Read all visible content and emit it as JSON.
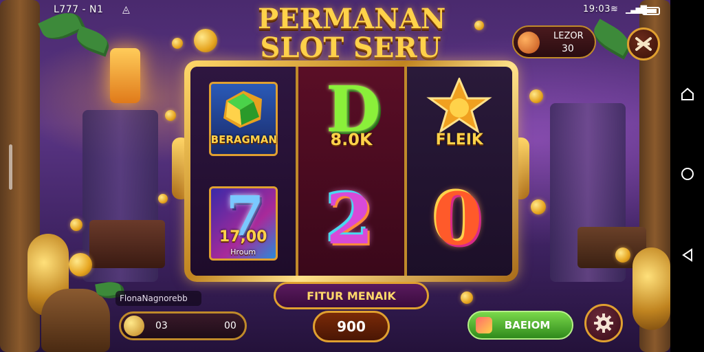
{
  "status_bar": {
    "left_text": "L777 - N1",
    "right_text": "19:03"
  },
  "title": {
    "line1": "PERMANAN",
    "line2": "SLOT SERU"
  },
  "top_right": {
    "lezor_label": "LEZOR",
    "lezor_value": "30"
  },
  "reels": [
    {
      "top": {
        "symbol": "gem-icon",
        "label": "BERAGMAN"
      },
      "bottom": {
        "symbol": "seven-icon",
        "digit": "7",
        "label": "17,00",
        "sublabel": "Hroum"
      }
    },
    {
      "top": {
        "symbol": "d-icon",
        "digit": "D",
        "label": "8.0K"
      },
      "bottom": {
        "symbol": "two-icon",
        "digit": "2"
      }
    },
    {
      "top": {
        "symbol": "star-icon",
        "label": "FLEIK"
      },
      "bottom": {
        "symbol": "zero-icon",
        "digit": "0"
      }
    }
  ],
  "controls": {
    "feature_label": "FITUR MENAIK",
    "bet_value": "900",
    "player_name": "FlonaNagnorebb",
    "balance_left": "03",
    "balance_right": "00",
    "bonus_label": "BAEIOM"
  },
  "colors": {
    "gold": "#e0a030",
    "bonus_green": "#3fa82a",
    "reel_magenta": "#5a0e26"
  }
}
